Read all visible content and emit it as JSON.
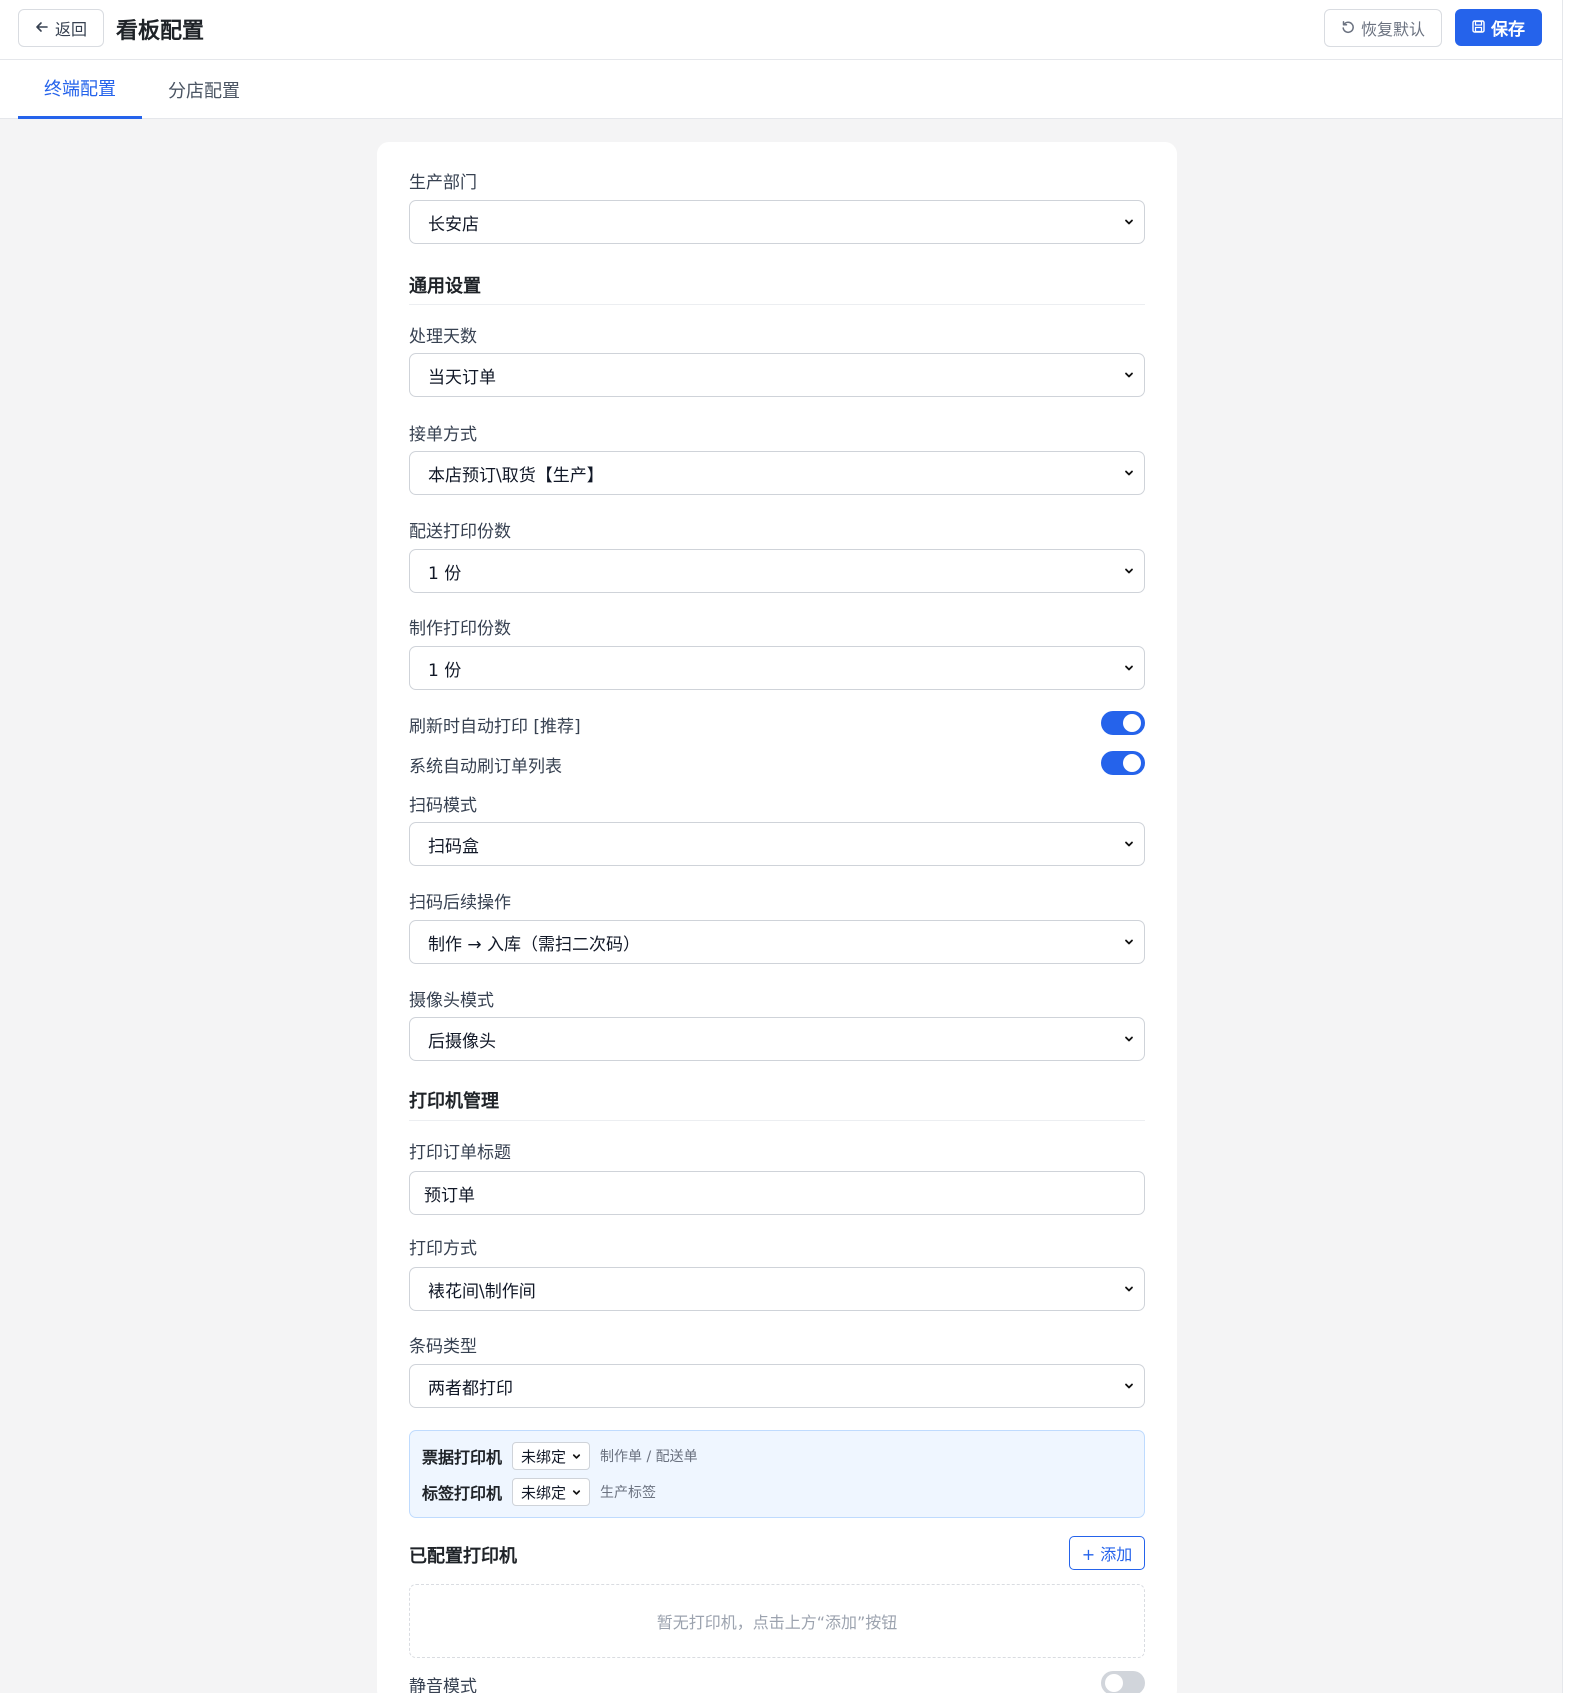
{
  "header": {
    "back_label": "返回",
    "title": "看板配置",
    "reset_label": "恢复默认",
    "save_label": "保存"
  },
  "tabs": [
    {
      "label": "终端配置",
      "active": true
    },
    {
      "label": "分店配置",
      "active": false
    }
  ],
  "form": {
    "department": {
      "label": "生产部门",
      "value": "长安店"
    },
    "general_section": "通用设置",
    "process_days": {
      "label": "处理天数",
      "value": "当天订单"
    },
    "order_mode": {
      "label": "接单方式",
      "value": "本店预订\\取货【生产】"
    },
    "delivery_copies": {
      "label": "配送打印份数",
      "value": "1 份"
    },
    "make_copies": {
      "label": "制作打印份数",
      "value": "1 份"
    },
    "auto_print": {
      "label": "刷新时自动打印 [推荐]",
      "on": true
    },
    "auto_refresh": {
      "label": "系统自动刷订单列表",
      "on": true
    },
    "scan_mode": {
      "label": "扫码模式",
      "value": "扫码盒"
    },
    "scan_followup": {
      "label": "扫码后续操作",
      "value": "制作 → 入库（需扫二次码）"
    },
    "camera_mode": {
      "label": "摄像头模式",
      "value": "后摄像头"
    },
    "printer_section": "打印机管理",
    "print_title": {
      "label": "打印订单标题",
      "value": "预订单"
    },
    "print_method": {
      "label": "打印方式",
      "value": "裱花间\\制作间"
    },
    "barcode_type": {
      "label": "条码类型",
      "value": "两者都打印"
    },
    "printer_bindings": [
      {
        "title": "票据打印机",
        "value": "未绑定",
        "hint": "制作单 / 配送单"
      },
      {
        "title": "标签打印机",
        "value": "未绑定",
        "hint": "生产标签"
      }
    ],
    "configured_title": "已配置打印机",
    "add_label": "+ 添加",
    "empty_text": "暂无打印机，点击上方“添加”按钮",
    "silent_mode": {
      "label": "静音模式",
      "on": false
    }
  },
  "colors": {
    "accent": "#2563eb",
    "background": "#f4f4f5",
    "printer_box_bg": "#eff6ff"
  }
}
